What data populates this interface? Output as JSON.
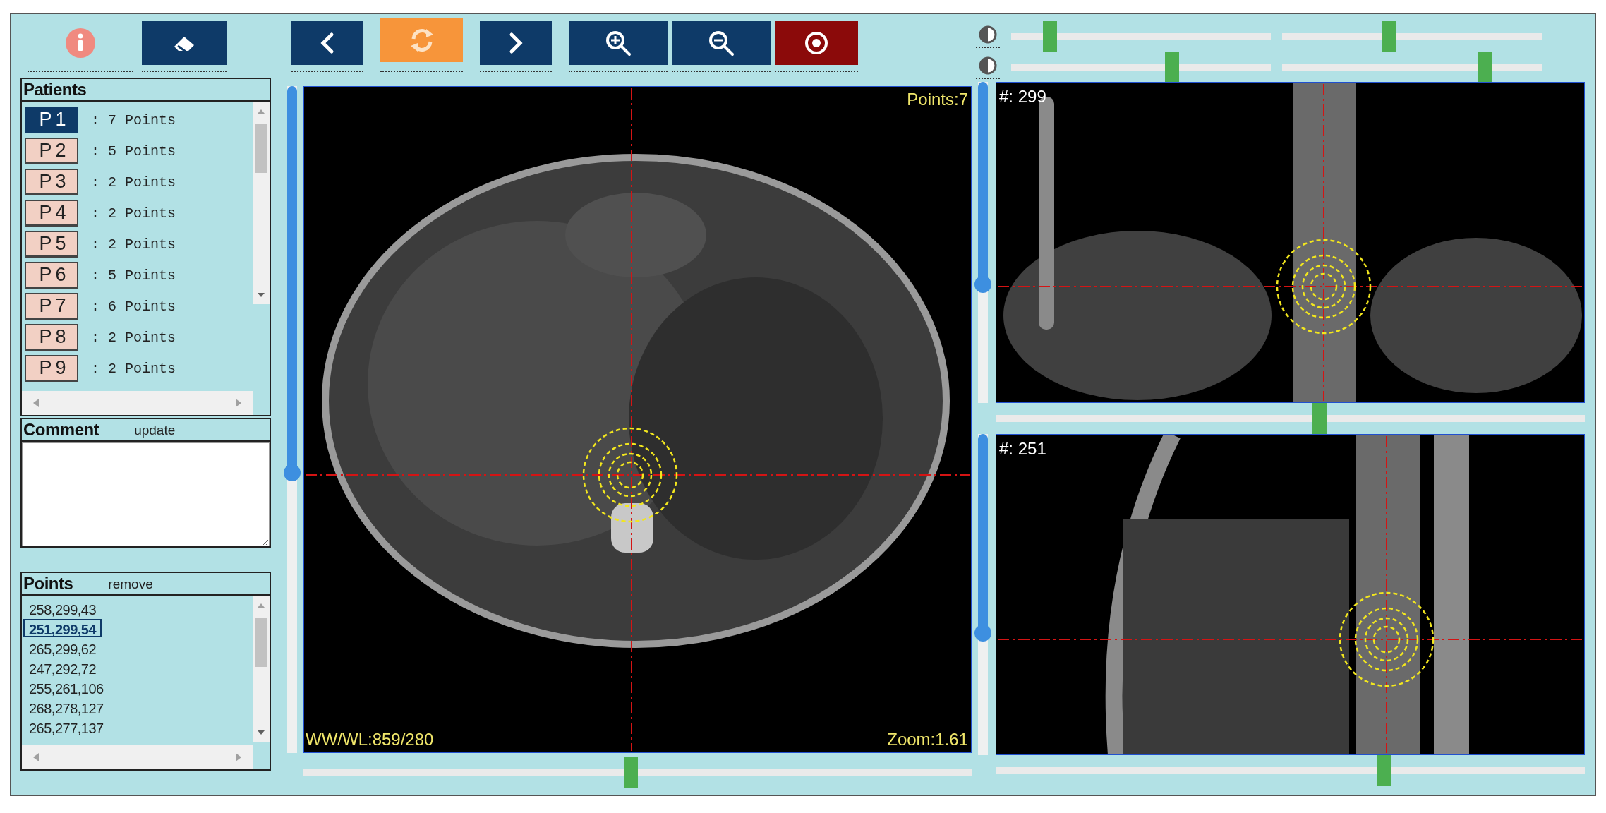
{
  "toolbar": [
    {
      "kind": "info"
    },
    {
      "kind": "eraser",
      "active": false
    },
    {
      "kind": "previous",
      "active": false
    },
    {
      "kind": "refresh",
      "active": true
    },
    {
      "kind": "next",
      "active": false
    },
    {
      "kind": "zoom_in",
      "active": false
    },
    {
      "kind": "zoom_out",
      "active": false
    },
    {
      "kind": "record"
    }
  ],
  "patients": {
    "title": "Patients",
    "items": [
      {
        "label": "P1",
        "count": ": 7 Points",
        "selected": true
      },
      {
        "label": "P2",
        "count": ": 5 Points",
        "selected": false
      },
      {
        "label": "P3",
        "count": ": 2 Points",
        "selected": false
      },
      {
        "label": "P4",
        "count": ": 2 Points",
        "selected": false
      },
      {
        "label": "P5",
        "count": ": 2 Points",
        "selected": false
      },
      {
        "label": "P6",
        "count": ": 5 Points",
        "selected": false
      },
      {
        "label": "P7",
        "count": ": 6 Points",
        "selected": false
      },
      {
        "label": "P8",
        "count": ": 2 Points",
        "selected": false
      },
      {
        "label": "P9",
        "count": ": 2 Points",
        "selected": false
      }
    ]
  },
  "comment": {
    "title": "Comment",
    "action": "update"
  },
  "points": {
    "title": "Points",
    "action": "remove",
    "items": [
      {
        "label": "258,299,43",
        "selected": false
      },
      {
        "label": "251,299,54",
        "selected": true
      },
      {
        "label": "265,299,62",
        "selected": false
      },
      {
        "label": "247,292,72",
        "selected": false
      },
      {
        "label": "255,261,106",
        "selected": false
      },
      {
        "label": "268,278,127",
        "selected": false
      },
      {
        "label": "265,277,137",
        "selected": false
      }
    ]
  },
  "main_view": {
    "slice_slider": {
      "level": 0.58
    },
    "points_overlay": "Points:7",
    "window_level": "WW/WL:859/280",
    "zoom": "Zoom:1.61",
    "position_slider": {
      "level": 0.49
    }
  },
  "contrast_rows": [
    {
      "sliders": [
        {
          "level": 0.15
        },
        {
          "level": 0.41
        }
      ]
    },
    {
      "sliders": [
        {
          "level": 0.62
        },
        {
          "level": 0.78
        }
      ]
    }
  ],
  "side_views": [
    {
      "kind": "coronal",
      "slice_label": "#: 299",
      "slice_slider": {
        "level": 0.63
      },
      "position_slider": {
        "level": 0.55
      }
    },
    {
      "kind": "sagittal",
      "slice_label": "#: 251",
      "slice_slider": {
        "level": 0.62
      },
      "position_slider": {
        "level": 0.66
      }
    }
  ]
}
